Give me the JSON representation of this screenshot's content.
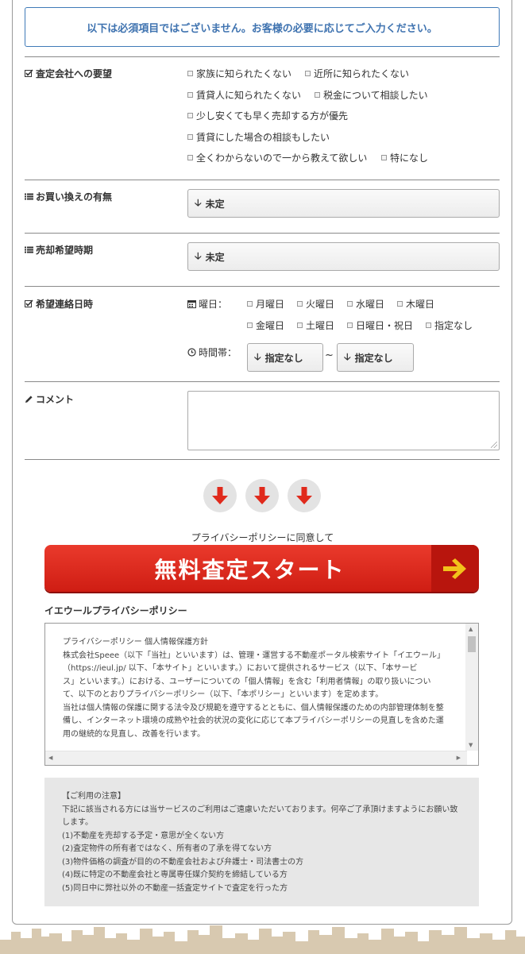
{
  "notice": {
    "text": "以下は必須項目ではございません。お客様の必要に応じてご入力ください。"
  },
  "requests": {
    "label": "査定会社への要望",
    "options": [
      "家族に知られたくない",
      "近所に知られたくない",
      "賃貸人に知られたくない",
      "税金について相談したい",
      "少し安くても早く売却する方が優先",
      "賃貸にした場合の相談もしたい",
      "全くわからないので一から教えて欲しい",
      "特になし"
    ]
  },
  "replacement": {
    "label": "お買い換えの有無",
    "value": "未定"
  },
  "sale_timing": {
    "label": "売却希望時期",
    "value": "未定"
  },
  "contact": {
    "label": "希望連絡日時",
    "day_label": "曜日：",
    "days": [
      "月曜日",
      "火曜日",
      "水曜日",
      "木曜日",
      "金曜日",
      "土曜日",
      "日曜日・祝日",
      "指定なし"
    ],
    "time_label": "時間帯：",
    "time_from": "指定なし",
    "separator": "~",
    "time_to": "指定なし"
  },
  "comment": {
    "label": "コメント"
  },
  "agree_text": "プライバシーポリシーに同意して",
  "cta": {
    "label": "無料査定スタート"
  },
  "privacy": {
    "title": "イエウールプライバシーポリシー",
    "lines": [
      "プライバシーポリシー 個人情報保護方針",
      "株式会社Speee（以下「当社」といいます）は、管理・運営する不動産ポータル検索サイト「イエウール」",
      "（https://ieul.jp/ 以下、「本サイト」といいます。）において提供されるサービス（以下、「本サービ",
      "ス」といいます。）における、ユーザーについての「個人情報」を含む「利用者情報」の取り扱いについ",
      "て、以下のとおりプライバシーポリシー（以下、「本ポリシー」といいます）を定めます。",
      "当社は個人情報の保護に関する法令及び規範を遵守するとともに、個人情報保護のための内部管理体制を整",
      "備し、インターネット環境の成熟や社会的状況の変化に応じて本プライバシーポリシーの見直しを含めた運",
      "用の継続的な見直し、改善を行います。"
    ]
  },
  "caution": {
    "lines": [
      "【ご利用の注意】",
      "下記に該当される方には当サービスのご利用はご遠慮いただいております。何卒ご了承頂けますようにお願い致",
      "します。",
      "(1)不動産を売却する予定・意思が全くない方",
      "(2)査定物件の所有者ではなく、所有者の了承を得てない方",
      "(3)物件価格の調査が目的の不動産会社および弁護士・司法書士の方",
      "(4)既に特定の不動産会社と専属専任媒介契約を締結している方",
      "(5)同日中に弊社以外の不動産一括査定サイトで査定を行った方"
    ]
  },
  "colors": {
    "accent_blue": "#3f73b0",
    "cta_red": "#d9261b",
    "cta_arrow": "#f2c21b",
    "skyline": "#d8c9b0"
  }
}
